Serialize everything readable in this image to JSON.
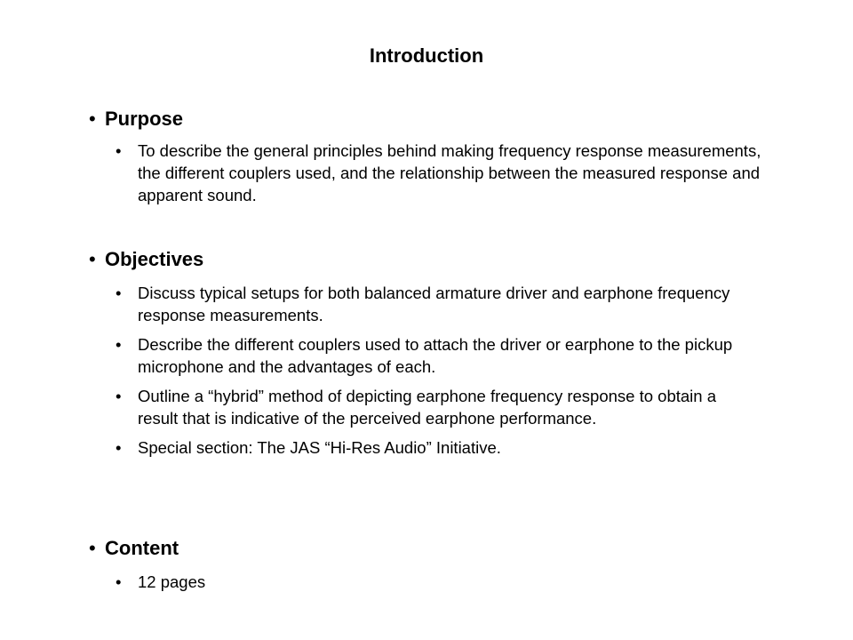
{
  "slide": {
    "title": "Introduction",
    "bullet_glyph": "•",
    "sections": [
      {
        "heading": "Purpose",
        "items": [
          "To describe the general principles behind making frequency response measurements, the different couplers used, and the relationship between the measured response and apparent sound."
        ]
      },
      {
        "heading": "Objectives",
        "items": [
          "Discuss typical setups for both balanced armature driver and earphone frequency response measurements.",
          "Describe the different couplers used to attach the driver or earphone to the pickup microphone and the advantages of each.",
          "Outline a “hybrid” method of depicting earphone frequency response to obtain a result that is indicative of the perceived earphone performance.",
          "Special section: The JAS “Hi-Res Audio” Initiative."
        ]
      },
      {
        "heading": "Content",
        "items": [
          "12 pages"
        ]
      }
    ]
  }
}
